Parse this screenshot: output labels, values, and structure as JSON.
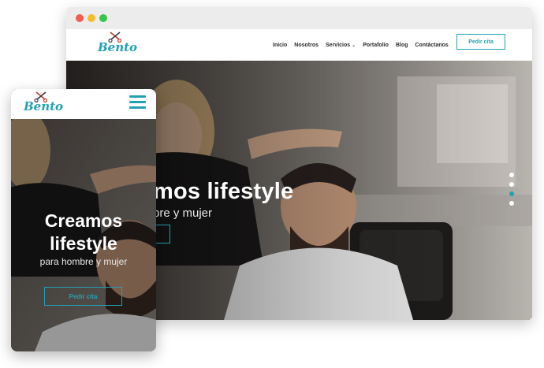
{
  "brand": {
    "name": "Bento",
    "accent": "#24a0b6"
  },
  "desktop": {
    "nav": [
      {
        "label": "Inicio"
      },
      {
        "label": "Nosotros"
      },
      {
        "label": "Servicios",
        "dropdown": true
      },
      {
        "label": "Portafolio"
      },
      {
        "label": "Blog"
      },
      {
        "label": "Contáctanos"
      }
    ],
    "cta_label": "Pedir cita",
    "hero": {
      "headline": "mos lifestyle",
      "subtitle": "bre y mujer"
    },
    "slider": {
      "dots": 4,
      "active_index": 2
    }
  },
  "mobile": {
    "hero": {
      "headline_line1": "Creamos",
      "headline_line2": "lifestyle",
      "subtitle": "para hombre y mujer",
      "cta_label": "Pedir cita"
    }
  }
}
